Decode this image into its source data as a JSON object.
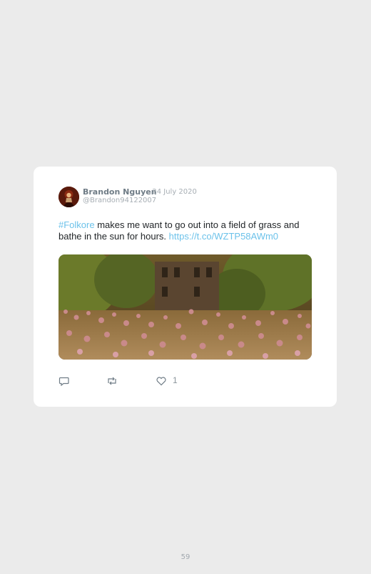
{
  "tweet": {
    "author_name": "Brandon Nguyen",
    "date": "· 24 July 2020",
    "handle": "@Brandon94122007",
    "hashtag": "#Folkore",
    "text_main": " makes me want to go out into a field of grass and bathe in the sun for hours. ",
    "link": "https://t.co/WZTP58AWm0",
    "likes": "1",
    "icons": {
      "reply": "reply-icon",
      "retweet": "retweet-icon",
      "like": "heart-icon"
    }
  },
  "page": {
    "number": "59"
  },
  "colors": {
    "background": "#ebebeb",
    "card": "#ffffff",
    "link": "#6cc2ea",
    "name": "#6f7c86",
    "meta": "#a7aeb4"
  }
}
